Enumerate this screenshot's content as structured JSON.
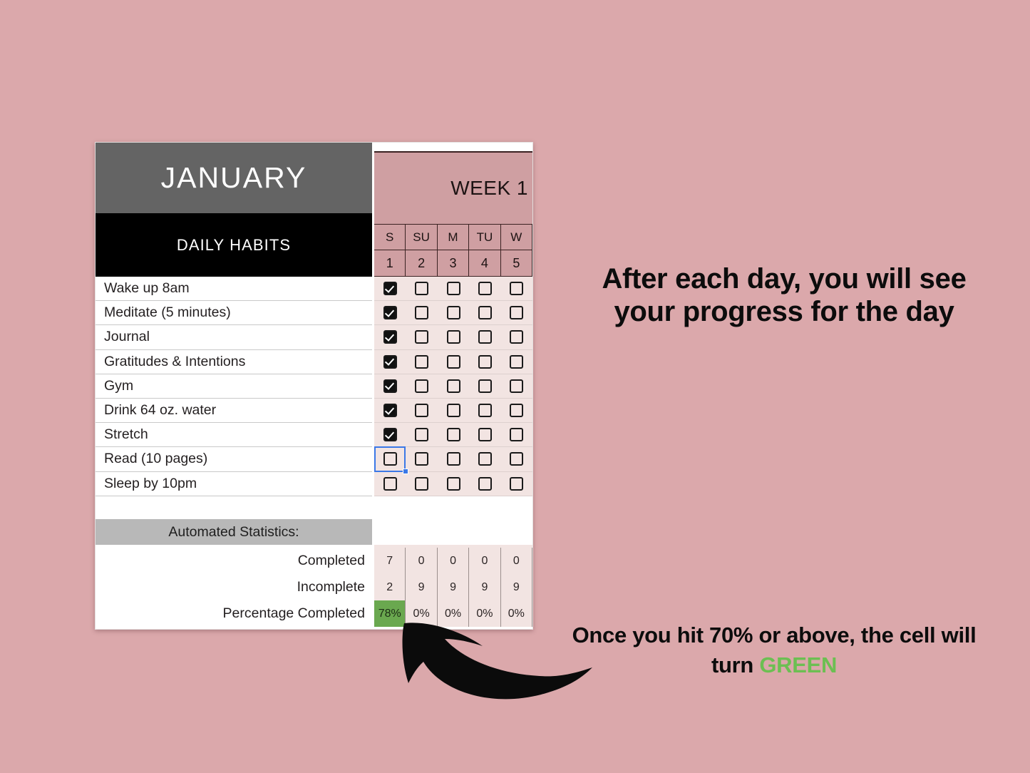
{
  "tracker": {
    "month": "JANUARY",
    "subtitle": "DAILY HABITS",
    "week_label": "WEEK 1",
    "day_names": [
      "S",
      "SU",
      "M",
      "TU",
      "W"
    ],
    "day_numbers": [
      "1",
      "2",
      "3",
      "4",
      "5"
    ],
    "habits": [
      {
        "label": "Wake up 8am",
        "checks": [
          true,
          false,
          false,
          false,
          false
        ]
      },
      {
        "label": "Meditate (5 minutes)",
        "checks": [
          true,
          false,
          false,
          false,
          false
        ]
      },
      {
        "label": "Journal",
        "checks": [
          true,
          false,
          false,
          false,
          false
        ]
      },
      {
        "label": "Gratitudes & Intentions",
        "checks": [
          true,
          false,
          false,
          false,
          false
        ]
      },
      {
        "label": "Gym",
        "checks": [
          true,
          false,
          false,
          false,
          false
        ]
      },
      {
        "label": "Drink 64 oz. water",
        "checks": [
          true,
          false,
          false,
          false,
          false
        ]
      },
      {
        "label": "Stretch",
        "checks": [
          true,
          false,
          false,
          false,
          false
        ]
      },
      {
        "label": "Read (10 pages)",
        "checks": [
          false,
          false,
          false,
          false,
          false
        ]
      },
      {
        "label": "Sleep by 10pm",
        "checks": [
          false,
          false,
          false,
          false,
          false
        ]
      }
    ],
    "selected_cell": {
      "row": 7,
      "col": 0
    },
    "stats_banner": "Automated Statistics:",
    "stats": [
      {
        "label": "Completed",
        "values": [
          "7",
          "0",
          "0",
          "0",
          "0"
        ],
        "highlight": [
          false,
          false,
          false,
          false,
          false
        ]
      },
      {
        "label": "Incomplete",
        "values": [
          "2",
          "9",
          "9",
          "9",
          "9"
        ],
        "highlight": [
          false,
          false,
          false,
          false,
          false
        ]
      },
      {
        "label": "Percentage Completed",
        "values": [
          "78%",
          "0%",
          "0%",
          "0%",
          "0%"
        ],
        "highlight": [
          true,
          false,
          false,
          false,
          false
        ]
      }
    ]
  },
  "annotations": {
    "top": "After each day, you will see your progress for the day",
    "bottom_before": "Once you hit 70% or above, the cell will turn ",
    "bottom_green": "GREEN"
  },
  "colors": {
    "page_background": "#dba8ab",
    "month_header": "#646464",
    "subtitle_header": "#000000",
    "week_pink": "#cf9fa2",
    "grid_pink": "#f2e4e2",
    "stats_banner_gray": "#b8b8b8",
    "highlight_green": "#6aa84f",
    "annotation_green": "#6cbf52",
    "selection_blue": "#3b78e7"
  }
}
